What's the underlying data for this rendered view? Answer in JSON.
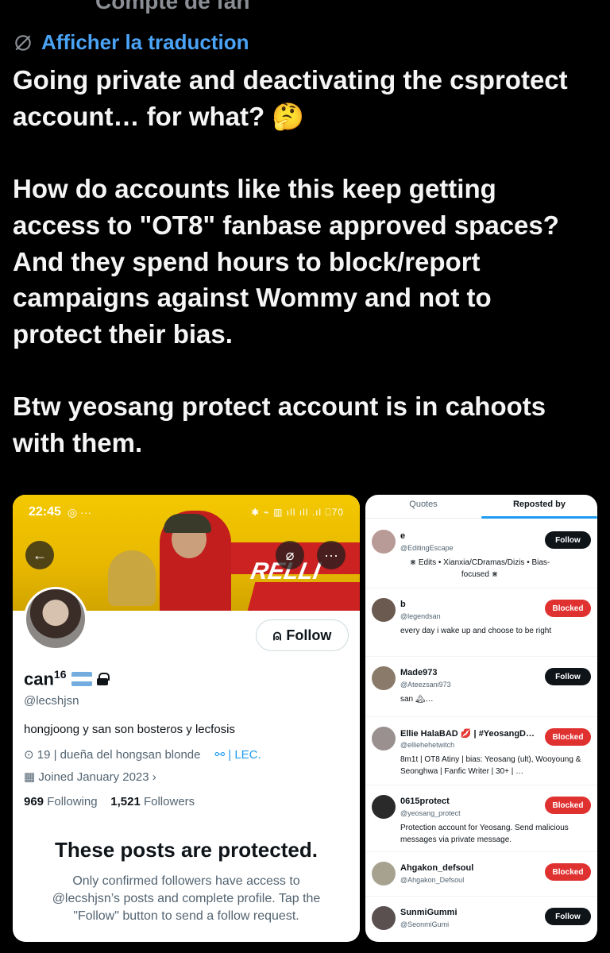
{
  "top_cut_text": "Compte de fan",
  "translate_label": "Afficher la traduction",
  "post": {
    "line1": "Going private and deactivating the csprotect",
    "line2": "account… for what? 🤔",
    "line3": "How do accounts like this keep getting",
    "line4": "access to \"OT8\" fanbase approved spaces?",
    "line5": "And they spend hours to  block/report",
    "line6": "campaigns against Wommy and not to",
    "line7": "protect their bias.",
    "line8": "Btw yeosang protect account is in cahoots",
    "line9": "with them."
  },
  "profile": {
    "status_time": "22:45",
    "status_battery": "70",
    "follow_label": "Follow",
    "name": "can",
    "name_sup": "16",
    "handle": "@lecshjsn",
    "bio": "hongjoong y san son bosteros y lecfosis",
    "location": "19 | dueña del hongsan blonde",
    "link": "| LEC.",
    "joined": "Joined January 2023",
    "following_count": "969",
    "following_label": "Following",
    "followers_count": "1,521",
    "followers_label": "Followers",
    "protected_title": "These posts are protected.",
    "protected_body": "Only confirmed followers have access to @lecshjsn’s posts and complete profile. Tap the \"Follow\" button to send a follow request.",
    "banner_text": "RELLI"
  },
  "reposts": {
    "tab_quotes": "Quotes",
    "tab_reposted": "Reposted by",
    "users": [
      {
        "name": "e",
        "handle": "@EditingEscape",
        "bio": "⋇ Edits • Xianxia/CDramas/Dizis • Bias-focused ⋇",
        "action": "Follow"
      },
      {
        "name": "b",
        "handle": "@legendsan",
        "bio": "every day i wake up and choose to be right",
        "action": "Blocked"
      },
      {
        "name": "Made973",
        "handle": "@Ateezsani973",
        "bio": "san 🏔…",
        "action": "Follow"
      },
      {
        "name": "Ellie HalaBAD 💋 | #YeosangD…",
        "handle": "@elliehehetwitch",
        "bio": "8m1t | OT8 Atiny | bias: Yeosang (ult), Wooyoung & Seonghwa | Fanfic Writer | 30+ | …",
        "action": "Blocked"
      },
      {
        "name": "0615protect",
        "handle": "@yeosang_protect",
        "bio": "Protection account for Yeosang. Send malicious messages via private message.",
        "action": "Blocked"
      },
      {
        "name": "Ahgakon_defsoul",
        "handle": "@Ahgakon_Defsoul",
        "bio": "",
        "action": "Blocked"
      },
      {
        "name": "SunmiGummi",
        "handle": "@SeonmiGumi",
        "bio": "",
        "action": "Follow"
      }
    ]
  }
}
